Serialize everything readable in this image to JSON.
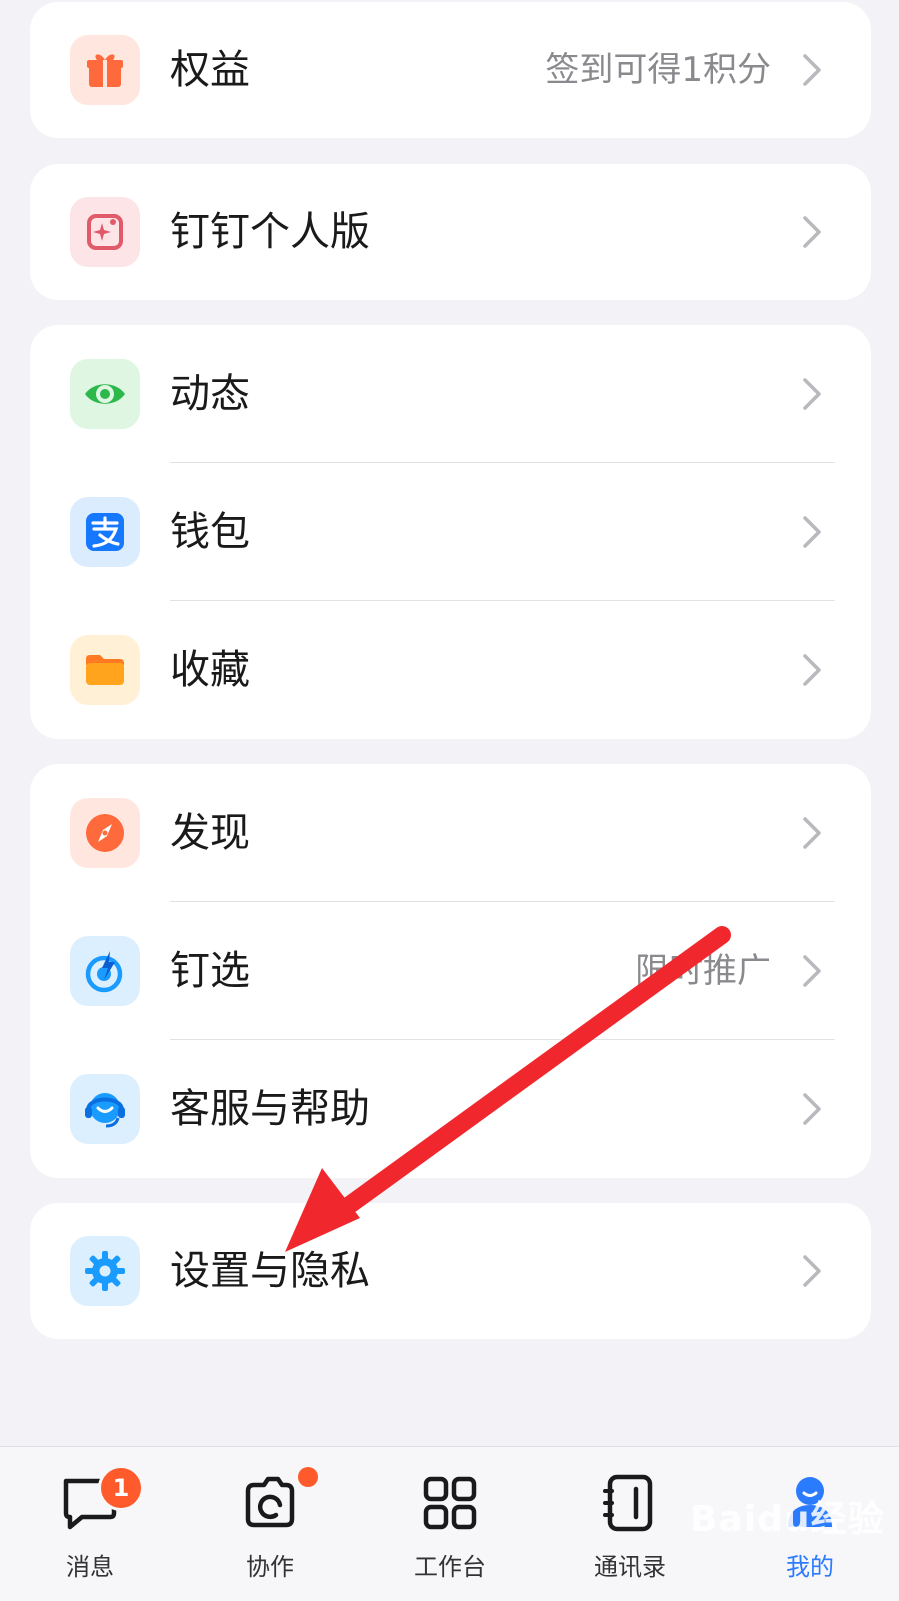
{
  "cards": [
    {
      "items": [
        {
          "label": "权益",
          "sub": "签到可得1积分",
          "icon": "gift-icon",
          "color": "#ff6a3d",
          "bg": "#ffe6de"
        }
      ]
    },
    {
      "items": [
        {
          "label": "钉钉个人版",
          "sub": "",
          "icon": "sparkle-card-icon",
          "color": "#e05a6a",
          "bg": "#fde4e6"
        }
      ]
    },
    {
      "items": [
        {
          "label": "动态",
          "sub": "",
          "icon": "eye-icon",
          "color": "#2db84b",
          "bg": "#dff6e2"
        },
        {
          "label": "钱包",
          "sub": "",
          "icon": "alipay-icon",
          "color": "#1677ff",
          "bg": "#dcecff"
        },
        {
          "label": "收藏",
          "sub": "",
          "icon": "folder-icon",
          "color": "#ffa41c",
          "bg": "#fff0d6"
        }
      ]
    },
    {
      "items": [
        {
          "label": "发现",
          "sub": "",
          "icon": "compass-icon",
          "color": "#ff6a3d",
          "bg": "#ffe6de"
        },
        {
          "label": "钉选",
          "sub": "限时推广",
          "icon": "target-bolt-icon",
          "color": "#1a9bff",
          "bg": "#dcefff"
        },
        {
          "label": "客服与帮助",
          "sub": "",
          "icon": "headset-icon",
          "color": "#1a9bff",
          "bg": "#dcefff"
        }
      ]
    },
    {
      "items": [
        {
          "label": "设置与隐私",
          "sub": "",
          "icon": "gear-icon",
          "color": "#1a9bff",
          "bg": "#dcefff"
        }
      ]
    }
  ],
  "tabs": [
    {
      "label": "消息",
      "icon": "chat-icon",
      "badge": "1"
    },
    {
      "label": "协作",
      "icon": "collab-icon"
    },
    {
      "label": "工作台",
      "icon": "grid-icon"
    },
    {
      "label": "通讯录",
      "icon": "contacts-icon"
    },
    {
      "label": "我的",
      "icon": "person-icon",
      "active": true
    }
  ],
  "colors": {
    "accent": "#2b7bff",
    "badge": "#ff5a2c",
    "annotation_arrow": "#f0282d"
  },
  "watermark": "Baidu经验"
}
